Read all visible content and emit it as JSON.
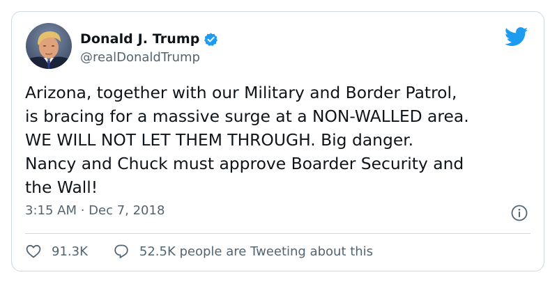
{
  "tweet": {
    "display_name": "Donald J. Trump",
    "handle": "@realDonaldTrump",
    "verified": true,
    "text_lines": [
      "Arizona, together with our Military and Border Patrol,",
      "is bracing for a massive surge at a NON-WALLED area.",
      "WE WILL NOT LET THEM THROUGH. Big danger.",
      "Nancy and Chuck must approve Boarder Security and",
      "the Wall!"
    ],
    "timestamp": "3:15 AM · Dec 7, 2018",
    "likes": "91.3K",
    "tweeting_about": "52.5K people are Tweeting about this"
  },
  "icons": {
    "brand": "twitter-bird-icon",
    "verified": "verified-badge-icon",
    "info": "info-icon",
    "like": "heart-icon",
    "reply": "speech-bubble-icon"
  },
  "colors": {
    "brand_blue": "#1d9bf0",
    "text_primary": "#0f1419",
    "text_secondary": "#536471",
    "border": "#cfd9de"
  }
}
